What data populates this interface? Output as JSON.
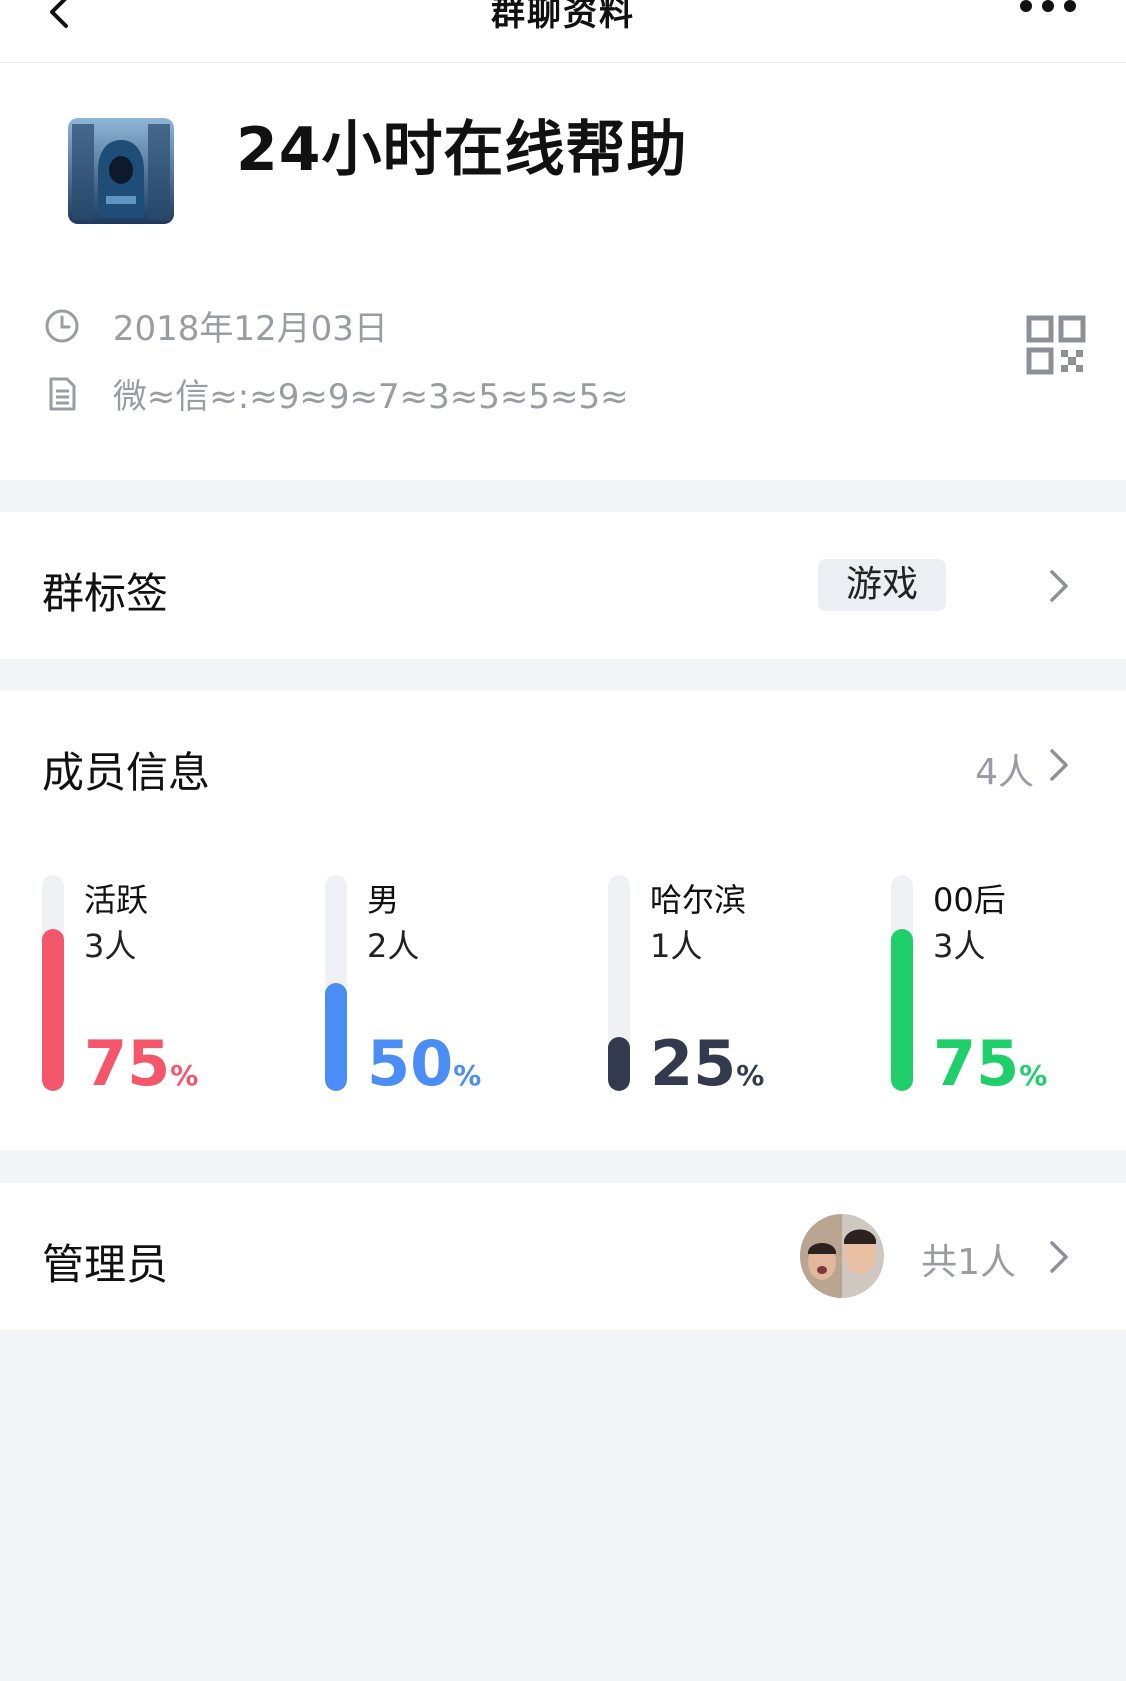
{
  "nav": {
    "title": "群聊资料",
    "back_icon": "chevron-left-icon",
    "more_icon": "more-dots-icon"
  },
  "group": {
    "name": "24小时在线帮助",
    "created_date": "2018年12月03日",
    "description": "微≈信≈:≈9≈9≈7≈3≈5≈5≈5≈"
  },
  "tags": {
    "label": "群标签",
    "value": "游戏"
  },
  "members": {
    "label": "成员信息",
    "count": "4人",
    "stats": [
      {
        "label": "活跃",
        "count": "3人",
        "percent": "75",
        "percent_sign": "%",
        "color": "#f4576b",
        "level": 0.75
      },
      {
        "label": "男",
        "count": "2人",
        "percent": "50",
        "percent_sign": "%",
        "color": "#4a8ef5",
        "level": 0.5
      },
      {
        "label": "哈尔滨",
        "count": "1人",
        "percent": "25",
        "percent_sign": "%",
        "color": "#333a4d",
        "level": 0.25
      },
      {
        "label": "00后",
        "count": "3人",
        "percent": "75",
        "percent_sign": "%",
        "color": "#1fcf6a",
        "level": 0.75
      }
    ]
  },
  "admins": {
    "label": "管理员",
    "count": "共1人"
  }
}
